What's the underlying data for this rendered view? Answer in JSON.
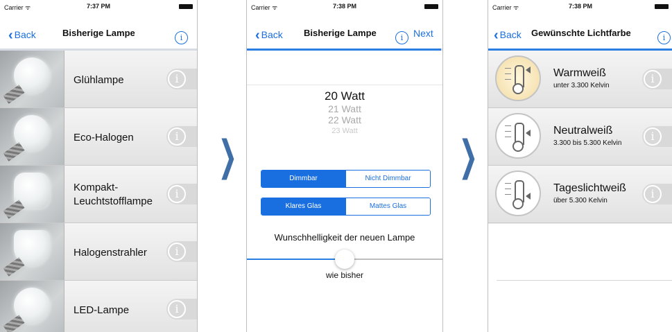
{
  "screen1": {
    "status": {
      "carrier": "Carrier ᯤ",
      "time": "7:37 PM"
    },
    "nav": {
      "back": "Back",
      "title": "Bisherige Lampe",
      "info": "i"
    },
    "rows": [
      {
        "label": "Glühlampe"
      },
      {
        "label": "Eco-Halogen"
      },
      {
        "label": "Kompakt-\nLeuchtstofflampe"
      },
      {
        "label": "Halogenstrahler"
      },
      {
        "label": "LED-Lampe"
      }
    ]
  },
  "screen2": {
    "status": {
      "carrier": "Carrier ᯤ",
      "time": "7:38 PM"
    },
    "nav": {
      "back": "Back",
      "title": "Bisherige Lampe",
      "info": "i",
      "next": "Next"
    },
    "picker": {
      "selected": "20 Watt",
      "options": [
        "21 Watt",
        "22 Watt",
        "23 Watt"
      ]
    },
    "seg_dimm": {
      "left": "Dimmbar",
      "right": "Nicht Dimmbar"
    },
    "seg_glass": {
      "left": "Klares Glas",
      "right": "Mattes Glas"
    },
    "wish_label": "Wunschhelligkeit der neuen Lampe",
    "slider_value_label": "wie bisher",
    "slider_fraction": 0.5
  },
  "screen3": {
    "status": {
      "carrier": "Carrier ᯤ",
      "time": "7:38 PM"
    },
    "nav": {
      "back": "Back",
      "title": "Gewünschte Lichtfarbe",
      "info": "i"
    },
    "rows": [
      {
        "name": "Warmweiß",
        "sub": "unter 3.300 Kelvin"
      },
      {
        "name": "Neutralweiß",
        "sub": "3.300 bis 5.300 Kelvin"
      },
      {
        "name": "Tageslichtweiß",
        "sub": "über 5.300 Kelvin"
      }
    ]
  },
  "colors": {
    "accent": "#1a6fe0",
    "arrow": "#3f6fa6"
  }
}
